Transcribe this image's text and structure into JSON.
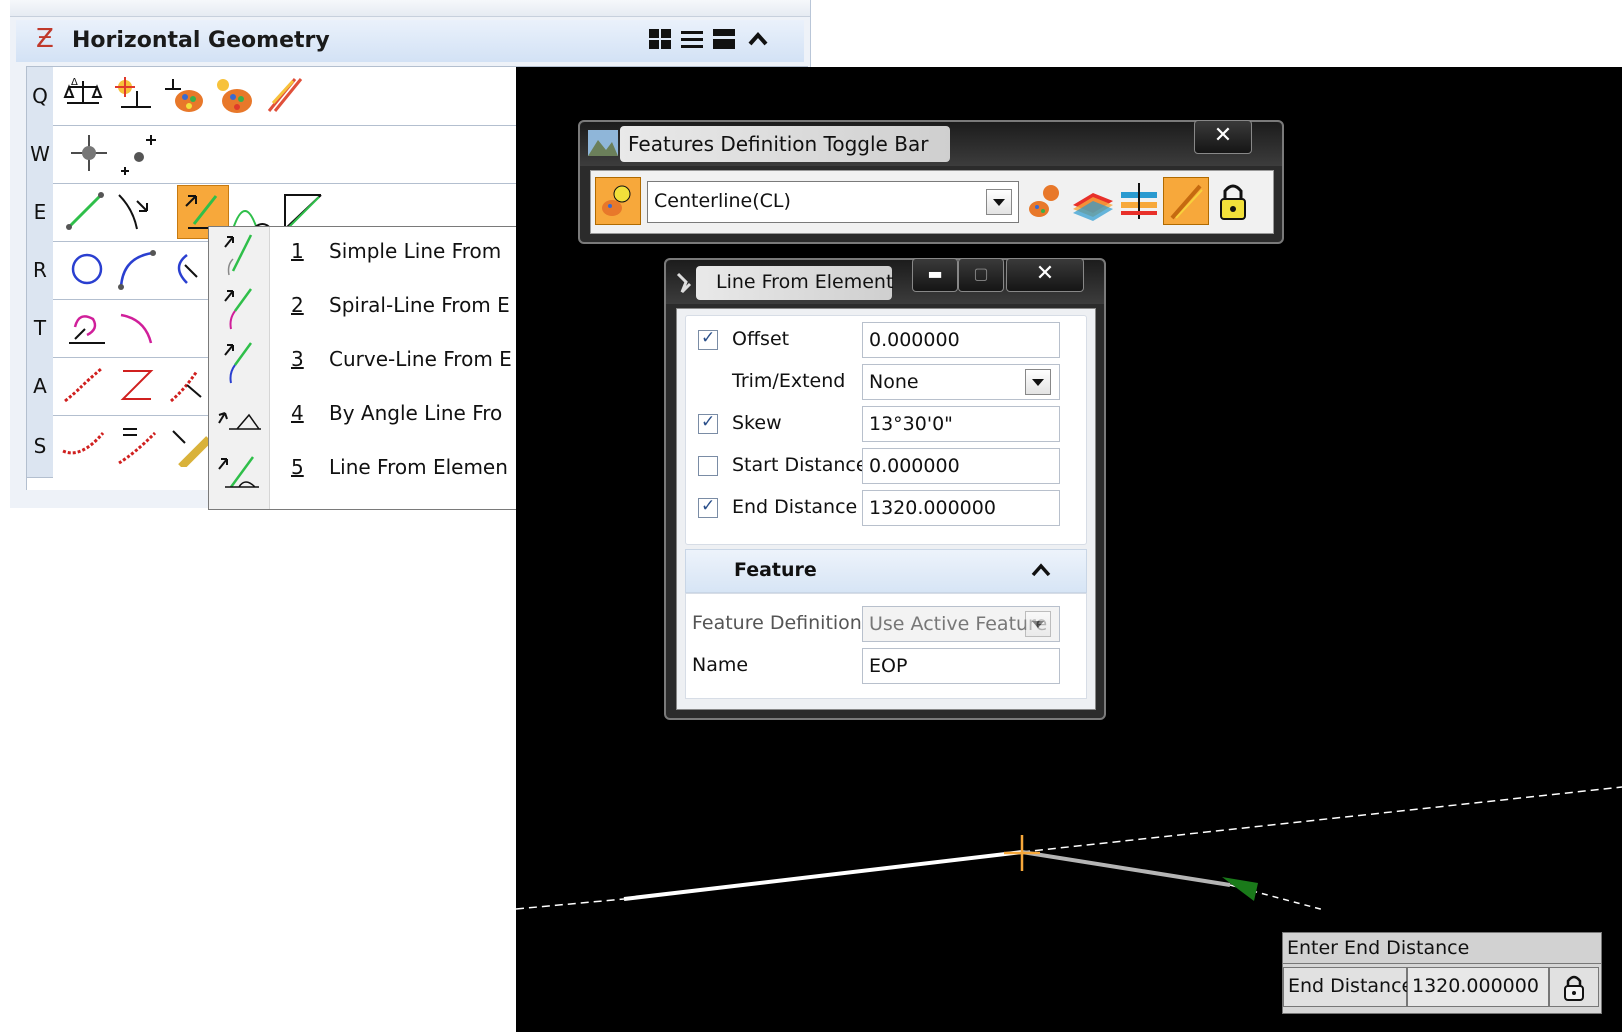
{
  "colors": {
    "canvas": "#000000",
    "accent": "#f7a83b",
    "panel_title": "#d3e2f5",
    "dialog_frame": "#2b2b2b"
  },
  "horizontal_geometry": {
    "title": "Horizontal Geometry",
    "title_icon": "z-geometry-icon",
    "toolbar_icons": [
      "grid-view-icon",
      "list-view-icon",
      "block-view-icon",
      "collapse-up-icon"
    ],
    "rows": [
      {
        "letter": "Q",
        "icons": [
          "balance-scale-icon",
          "balance-scale-star-icon",
          "balance-palette-icon",
          "palette-star-icon",
          "pencil-ribbon-icon"
        ]
      },
      {
        "letter": "W",
        "icons": [
          "point-cross-icon",
          "point-plus-icon"
        ]
      },
      {
        "letter": "E",
        "icons": [
          "line-icon",
          "line-arrow-icon",
          "line-from-element-icon",
          "curve-pair-icon",
          "corner-line-icon"
        ]
      },
      {
        "letter": "R",
        "icons": [
          "circle-icon",
          "arc-icon",
          "arc-arrow-icon"
        ]
      },
      {
        "letter": "T",
        "icons": [
          "spiral-icon",
          "curve-magenta-icon"
        ]
      },
      {
        "letter": "A",
        "icons": [
          "complex-red-icon",
          "z-complex-icon",
          "complex-arrow-icon"
        ]
      },
      {
        "letter": "S",
        "icons": [
          "complex-sweep-icon",
          "equal-complex-icon",
          "ruler-icon"
        ]
      }
    ]
  },
  "menu": {
    "items": [
      {
        "num": "1",
        "label": "Simple Line From",
        "icon": "simple-line-from-icon"
      },
      {
        "num": "2",
        "label": "Spiral-Line From E",
        "icon": "spiral-line-from-icon"
      },
      {
        "num": "3",
        "label": "Curve-Line From E",
        "icon": "curve-line-from-icon"
      },
      {
        "num": "4",
        "label": "By Angle Line Fro",
        "icon": "by-angle-line-icon"
      },
      {
        "num": "5",
        "label": "Line From Elemen",
        "icon": "line-from-element-icon"
      }
    ]
  },
  "features_toggle": {
    "title": "Features Definition Toggle Bar",
    "close": "✕",
    "selected": "Centerline(CL)",
    "icons": [
      "feature-bulb-icon",
      "feature-palette-icon",
      "terrain-icon",
      "corridor-icon",
      "pencil-active-icon",
      "lock-icon"
    ]
  },
  "line_from_element": {
    "title": "Line From Element",
    "minimize": "▬",
    "maximize": "▢",
    "close": "✕",
    "params": [
      {
        "label": "Offset",
        "checkbox": true,
        "checked": true,
        "value": "0.000000"
      },
      {
        "label": "Trim/Extend",
        "checkbox": false,
        "checked": false,
        "value": "None",
        "dropdown": true
      },
      {
        "label": "Skew",
        "checkbox": true,
        "checked": true,
        "value": "13°30'0\""
      },
      {
        "label": "Start Distance",
        "checkbox": true,
        "checked": false,
        "value": "0.000000"
      },
      {
        "label": "End Distance",
        "checkbox": true,
        "checked": true,
        "value": "1320.000000"
      }
    ],
    "feature_section": {
      "title": "Feature",
      "feature_definition_label": "Feature Definition",
      "feature_definition_value": "Use Active Feature",
      "name_label": "Name",
      "name_value": "EOP"
    }
  },
  "prompt": {
    "title": "Enter End Distance",
    "label": "End Distance",
    "value": "1320.000000",
    "icon": "lock-icon"
  }
}
